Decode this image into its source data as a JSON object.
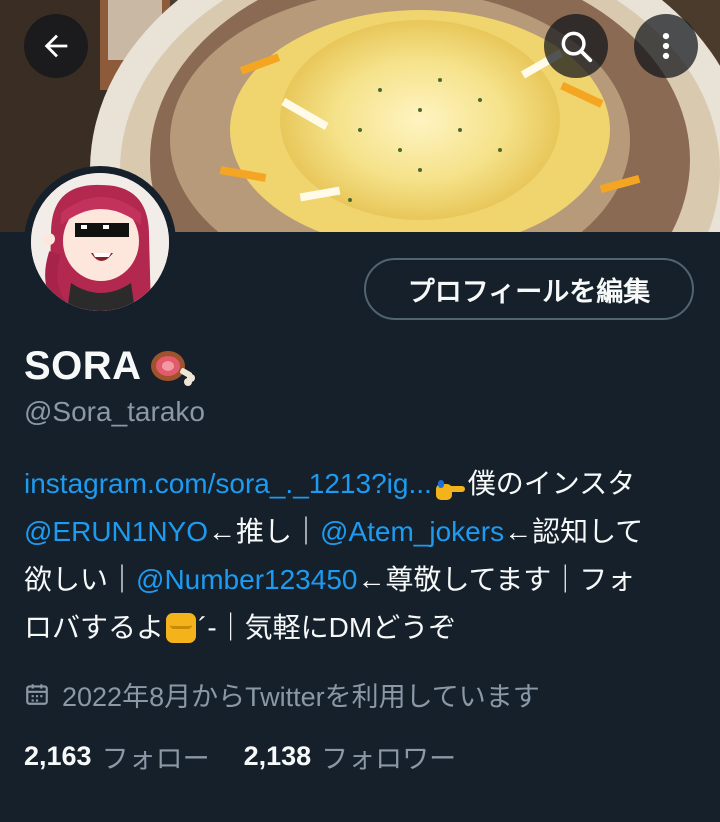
{
  "header": {
    "back_icon": "arrow-left-icon",
    "search_icon": "search-icon",
    "more_icon": "more-vertical-icon"
  },
  "profile": {
    "edit_button": "プロフィールを編集",
    "display_name": "SORA",
    "name_emoji": "meat-on-bone-icon",
    "handle": "@Sora_tarako",
    "bio": {
      "l1_link": "instagram.com/sora_._1213?ig...",
      "l1_text": "僕のインスタ",
      "l2_mention1": "@ERUN1NYO",
      "l2_text1": "←推し｜",
      "l2_mention2": "@Atem_jokers",
      "l2_text2": "←認知して",
      "l3_text1": "欲しい｜",
      "l3_mention": "@Number123450",
      "l3_text2": "←尊敬してます｜フォ",
      "l4_text1": "ロバするよ",
      "l4_text2": "´-｜気軽にDMどうぞ"
    },
    "joined": "2022年8月からTwitterを利用しています",
    "following_count": "2,163",
    "following_label": "フォロー",
    "followers_count": "2,138",
    "followers_label": "フォロワー"
  },
  "colors": {
    "background": "#15202b",
    "link": "#1d9bf0",
    "secondary_text": "#8b98a5",
    "border": "#536471"
  }
}
